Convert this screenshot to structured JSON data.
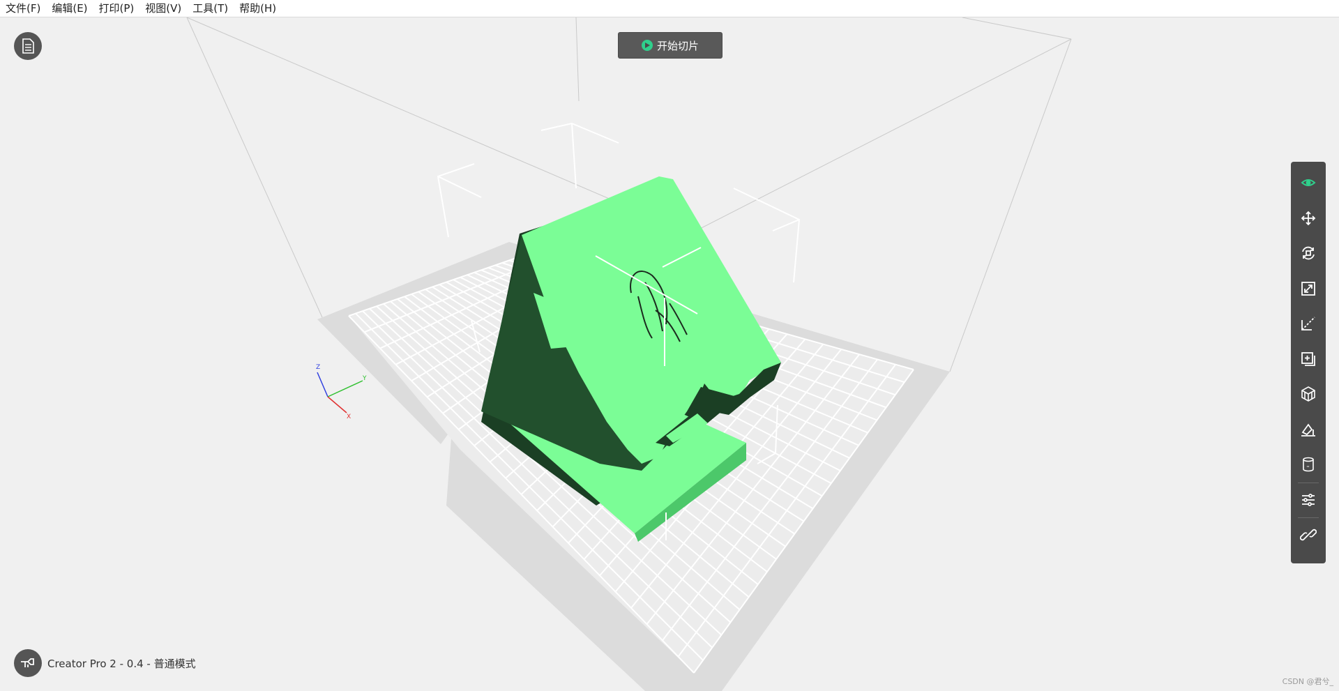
{
  "menu": {
    "file": "文件(F)",
    "edit": "编辑(E)",
    "print": "打印(P)",
    "view": "视图(V)",
    "tools": "工具(T)",
    "help": "帮助(H)"
  },
  "slice_button": {
    "label": "开始切片",
    "icon": "play-circle-icon"
  },
  "document_button": {
    "icon": "document-icon"
  },
  "printer": {
    "icon": "printer-icon",
    "label": "Creator Pro 2 - 0.4 - 普通模式"
  },
  "axis_labels": {
    "z": "Z",
    "y": "Y",
    "x": "X"
  },
  "toolbar": {
    "items": [
      {
        "icon": "eye-icon",
        "active": true
      },
      {
        "icon": "move-icon"
      },
      {
        "icon": "rotate-icon"
      },
      {
        "icon": "scale-icon"
      },
      {
        "icon": "cut-icon"
      },
      {
        "icon": "add-model-icon"
      },
      {
        "icon": "support-icon"
      },
      {
        "icon": "place-on-face-icon"
      },
      {
        "icon": "cylinder-icon"
      },
      {
        "icon": "settings-sliders-icon"
      },
      {
        "icon": "link-icon"
      }
    ]
  },
  "watermark": "CSDN @君兮_",
  "colors": {
    "accent": "#2fd08c",
    "model_light": "#7bfd96",
    "model_dark": "#1b3f24",
    "toolbar_bg": "#4a4a4a",
    "viewport_bg": "#f0f0f0"
  }
}
